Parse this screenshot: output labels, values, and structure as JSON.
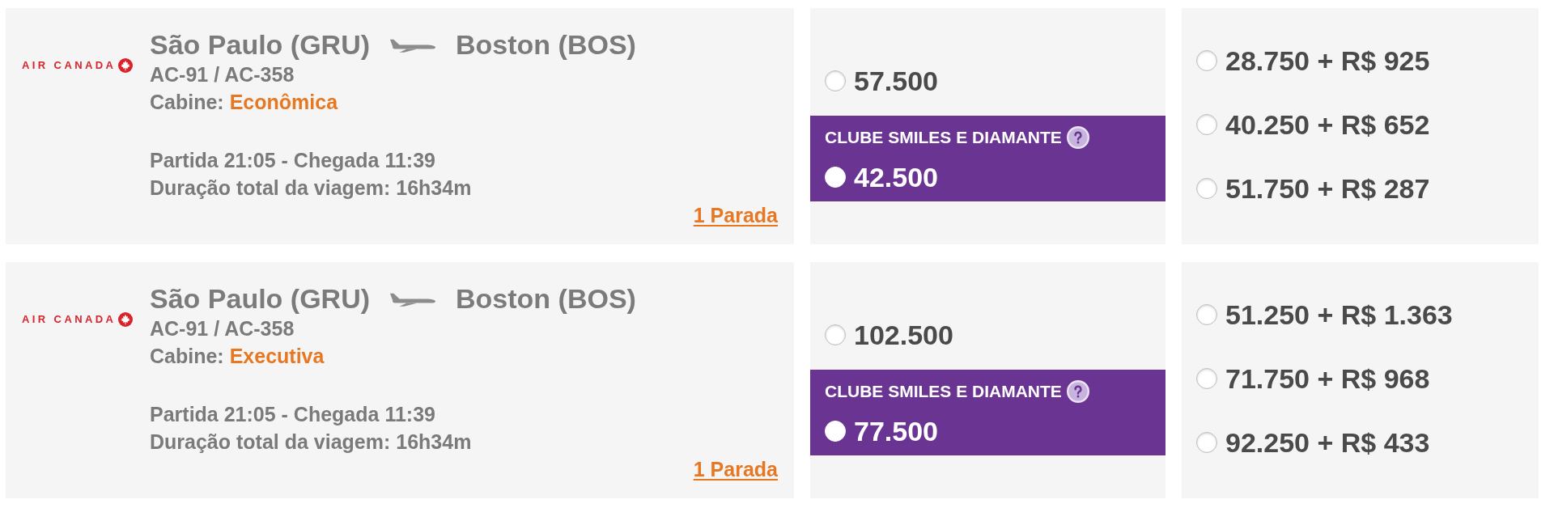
{
  "flights": [
    {
      "airline": "AIR CANADA",
      "origin": "São Paulo (GRU)",
      "destination": "Boston (BOS)",
      "flight_numbers": "AC-91 / AC-358",
      "cabin_label": "Cabine:",
      "cabin": "Econômica",
      "schedule": "Partida 21:05 - Chegada 11:39",
      "duration": "Duração total da viagem: 16h34m",
      "stops": "1 Parada",
      "miles_fare": {
        "price": "57.500",
        "selected": false
      },
      "club_fare": {
        "label": "CLUBE SMILES E DIAMANTE",
        "price": "42.500",
        "selected": false
      },
      "mixed_fares": [
        {
          "price": "28.750 + R$ 925",
          "selected": false
        },
        {
          "price": "40.250 + R$ 652",
          "selected": false
        },
        {
          "price": "51.750 + R$ 287",
          "selected": false
        }
      ]
    },
    {
      "airline": "AIR CANADA",
      "origin": "São Paulo (GRU)",
      "destination": "Boston (BOS)",
      "flight_numbers": "AC-91 / AC-358",
      "cabin_label": "Cabine:",
      "cabin": "Executiva",
      "schedule": "Partida 21:05 - Chegada 11:39",
      "duration": "Duração total da viagem: 16h34m",
      "stops": "1 Parada",
      "miles_fare": {
        "price": "102.500",
        "selected": false
      },
      "club_fare": {
        "label": "CLUBE SMILES E DIAMANTE",
        "price": "77.500",
        "selected": false
      },
      "mixed_fares": [
        {
          "price": "51.250 + R$ 1.363",
          "selected": false
        },
        {
          "price": "71.750 + R$ 968",
          "selected": false
        },
        {
          "price": "92.250 + R$ 433",
          "selected": false
        }
      ]
    }
  ]
}
